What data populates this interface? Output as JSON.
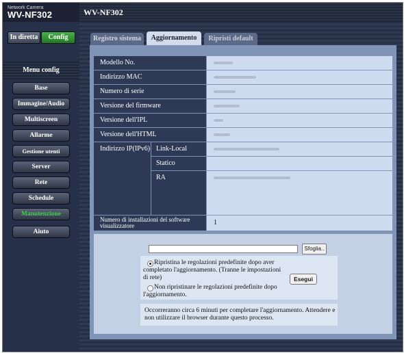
{
  "header": {
    "brand_small": "Network Camera",
    "brand_model": "WV-NF302",
    "title": "WV-NF302"
  },
  "top_buttons": {
    "live": "In diretta",
    "config": "Config"
  },
  "sidebar": {
    "heading": "Menu config",
    "items": [
      {
        "label": "Base"
      },
      {
        "label": "Immagine/Audio"
      },
      {
        "label": "Multiscreen"
      },
      {
        "label": "Allarme"
      },
      {
        "label": "Gestione utenti"
      },
      {
        "label": "Server"
      },
      {
        "label": "Rete"
      },
      {
        "label": "Schedule"
      },
      {
        "label": "Manutenzione"
      },
      {
        "label": "Aiuto"
      }
    ],
    "active_color": "#3fd046"
  },
  "tabs": [
    "Registro sistema",
    "Aggiornamento",
    "Ripristi default"
  ],
  "info": {
    "model": "Modello No.",
    "mac": "Indirizzo MAC",
    "serial": "Numero di serie",
    "firmware": "Versione del firmware",
    "ipl": "Versione dell'IPL",
    "html": "Versione dell'HTML",
    "ipv6": "Indirizzo IP(IPv6)",
    "link_local": "Link-Local",
    "static": "Statico",
    "ra": "RA",
    "installs_label": "Numero di installazioni del software visualizzatore",
    "installs_value": "1"
  },
  "update": {
    "browse": "Sfoglia..",
    "option1": "Ripristina le regolazioni predefinite dopo aver completato l'aggiornamento. (Tranne le impostazioni di rete)",
    "option2": "Non ripristinare le regolazioni predefinite dopo l'aggiornamento.",
    "execute": "Esegui",
    "note": "Occorreranno circa 6 minuti per completare l'aggiornamento. Attendere e non utilizzare il browser durante questo processo."
  }
}
